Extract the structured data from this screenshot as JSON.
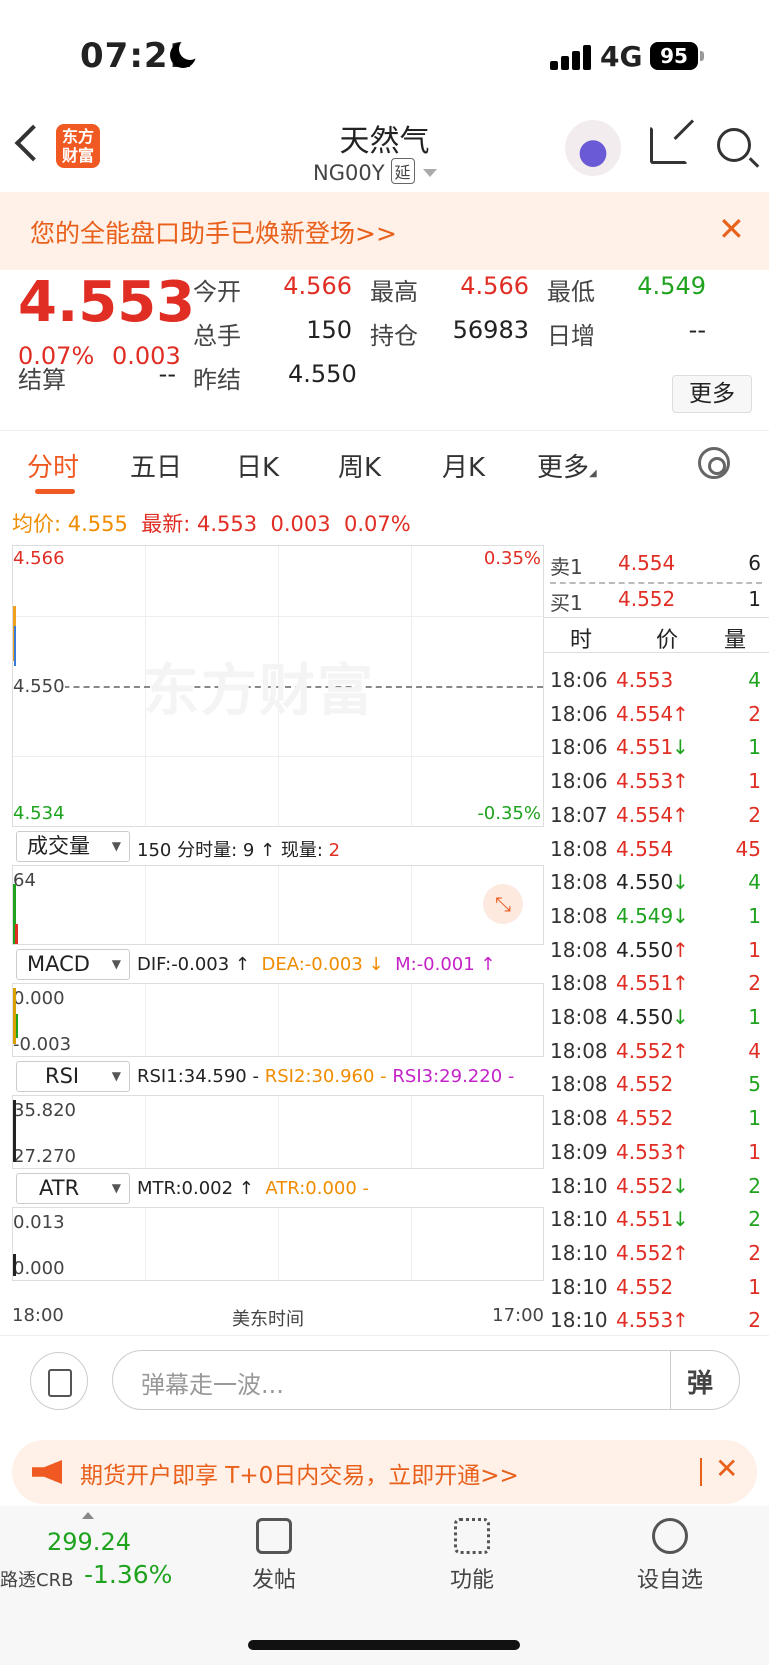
{
  "status": {
    "time": "07:21",
    "network": "4G",
    "battery": "95"
  },
  "header": {
    "logo_text": "东方财富",
    "title": "天然气",
    "code": "NG00Y",
    "delay_tag": "延"
  },
  "banner": {
    "text": "您的全能盘口助手已焕新登场>>",
    "close": "✕"
  },
  "quote": {
    "price": "4.553",
    "change_pct": "0.07%",
    "change": "0.003",
    "fields": [
      {
        "label": "今开",
        "value": "4.566",
        "color": "red"
      },
      {
        "label": "最高",
        "value": "4.566",
        "color": "red"
      },
      {
        "label": "最低",
        "value": "4.549",
        "color": "green"
      },
      {
        "label": "总手",
        "value": "150",
        "color": "dark"
      },
      {
        "label": "持仓",
        "value": "56983",
        "color": "dark"
      },
      {
        "label": "日增",
        "value": "--",
        "color": "dark"
      },
      {
        "label": "结算",
        "value": "--",
        "color": "dark"
      },
      {
        "label": "昨结",
        "value": "4.550",
        "color": "dark"
      }
    ],
    "more": "更多"
  },
  "tabs": [
    "分时",
    "五日",
    "日K",
    "周K",
    "月K",
    "更多"
  ],
  "avg_line": {
    "avg_label": "均价:",
    "avg_value": "4.555",
    "last_label": "最新:",
    "last_value": "4.553",
    "change": "0.003",
    "pct": "0.07%"
  },
  "chart": {
    "price_top": "4.566",
    "price_mid": "4.550",
    "price_bottom": "4.534",
    "pct_top": "0.35%",
    "pct_bottom": "-0.35%",
    "watermark": "东方财富",
    "volume": {
      "sel": "成交量",
      "text1": "150 分时量: 9 ↑ 现量: ",
      "text2": "2",
      "axis": "64"
    },
    "macd": {
      "sel": "MACD",
      "dif": "DIF:-0.003 ↑",
      "dea": "DEA:-0.003 ↓",
      "m": "M:-0.001 ↑",
      "axis_top": "0.000",
      "axis_bottom": "-0.003"
    },
    "rsi": {
      "sel": "RSI",
      "rsi1": "RSI1:34.590 -",
      "rsi2": "RSI2:30.960 -",
      "rsi3": "RSI3:29.220 -",
      "axis_top": "35.820",
      "axis_bottom": "27.270"
    },
    "atr": {
      "sel": "ATR",
      "mtr": "MTR:0.002 ↑",
      "atr": "ATR:0.000 -",
      "axis_top": "0.013",
      "axis_bottom": "0.000"
    },
    "x_start": "18:00",
    "x_mid": "美东时间",
    "x_end": "17:00"
  },
  "orderbook": [
    {
      "label": "卖1",
      "price": "4.554",
      "qty": "6"
    },
    {
      "label": "买1",
      "price": "4.552",
      "qty": "1"
    }
  ],
  "tape_header": [
    "时",
    "价",
    "量"
  ],
  "ticks": [
    {
      "time": "18:06",
      "price": "4.553",
      "arrow": "",
      "pc": "red",
      "qty": "4",
      "qc": "green"
    },
    {
      "time": "18:06",
      "price": "4.554",
      "arrow": "↑",
      "pc": "red",
      "qty": "2",
      "qc": "red"
    },
    {
      "time": "18:06",
      "price": "4.551",
      "arrow": "↓",
      "pc": "red",
      "qty": "1",
      "qc": "green"
    },
    {
      "time": "18:06",
      "price": "4.553",
      "arrow": "↑",
      "pc": "red",
      "qty": "1",
      "qc": "red"
    },
    {
      "time": "18:07",
      "price": "4.554",
      "arrow": "↑",
      "pc": "red",
      "qty": "2",
      "qc": "red"
    },
    {
      "time": "18:08",
      "price": "4.554",
      "arrow": "",
      "pc": "red",
      "qty": "45",
      "qc": "red"
    },
    {
      "time": "18:08",
      "price": "4.550",
      "arrow": "↓",
      "pc": "dark",
      "qty": "4",
      "qc": "green"
    },
    {
      "time": "18:08",
      "price": "4.549",
      "arrow": "↓",
      "pc": "green",
      "qty": "1",
      "qc": "green"
    },
    {
      "time": "18:08",
      "price": "4.550",
      "arrow": "↑",
      "pc": "dark",
      "qty": "1",
      "qc": "red"
    },
    {
      "time": "18:08",
      "price": "4.551",
      "arrow": "↑",
      "pc": "red",
      "qty": "2",
      "qc": "red"
    },
    {
      "time": "18:08",
      "price": "4.550",
      "arrow": "↓",
      "pc": "dark",
      "qty": "1",
      "qc": "green"
    },
    {
      "time": "18:08",
      "price": "4.552",
      "arrow": "↑",
      "pc": "red",
      "qty": "4",
      "qc": "red"
    },
    {
      "time": "18:08",
      "price": "4.552",
      "arrow": "",
      "pc": "red",
      "qty": "5",
      "qc": "green"
    },
    {
      "time": "18:08",
      "price": "4.552",
      "arrow": "",
      "pc": "red",
      "qty": "1",
      "qc": "green"
    },
    {
      "time": "18:09",
      "price": "4.553",
      "arrow": "↑",
      "pc": "red",
      "qty": "1",
      "qc": "red"
    },
    {
      "time": "18:10",
      "price": "4.552",
      "arrow": "↓",
      "pc": "red",
      "qty": "2",
      "qc": "green"
    },
    {
      "time": "18:10",
      "price": "4.551",
      "arrow": "↓",
      "pc": "red",
      "qty": "2",
      "qc": "green"
    },
    {
      "time": "18:10",
      "price": "4.552",
      "arrow": "↑",
      "pc": "red",
      "qty": "2",
      "qc": "red"
    },
    {
      "time": "18:10",
      "price": "4.552",
      "arrow": "",
      "pc": "red",
      "qty": "1",
      "qc": "red"
    },
    {
      "time": "18:10",
      "price": "4.553",
      "arrow": "↑",
      "pc": "red",
      "qty": "2",
      "qc": "red"
    }
  ],
  "input": {
    "placeholder": "弹幕走一波...",
    "danmu_button": "弹"
  },
  "ad": {
    "text": "期货开户即享 T+0日内交易，立即开通>>",
    "close": "✕"
  },
  "bottom_nav": {
    "crb_value": "299.24",
    "crb_label": "路透CRB",
    "crb_pct": "-1.36%",
    "items": [
      {
        "label": "发帖"
      },
      {
        "label": "功能"
      },
      {
        "label": "设自选"
      }
    ]
  },
  "colors": {
    "red": "#e02e24",
    "green": "#1fa31f",
    "orange": "#f05a22",
    "avg": "#f08c00",
    "purple": "#c423c8"
  }
}
